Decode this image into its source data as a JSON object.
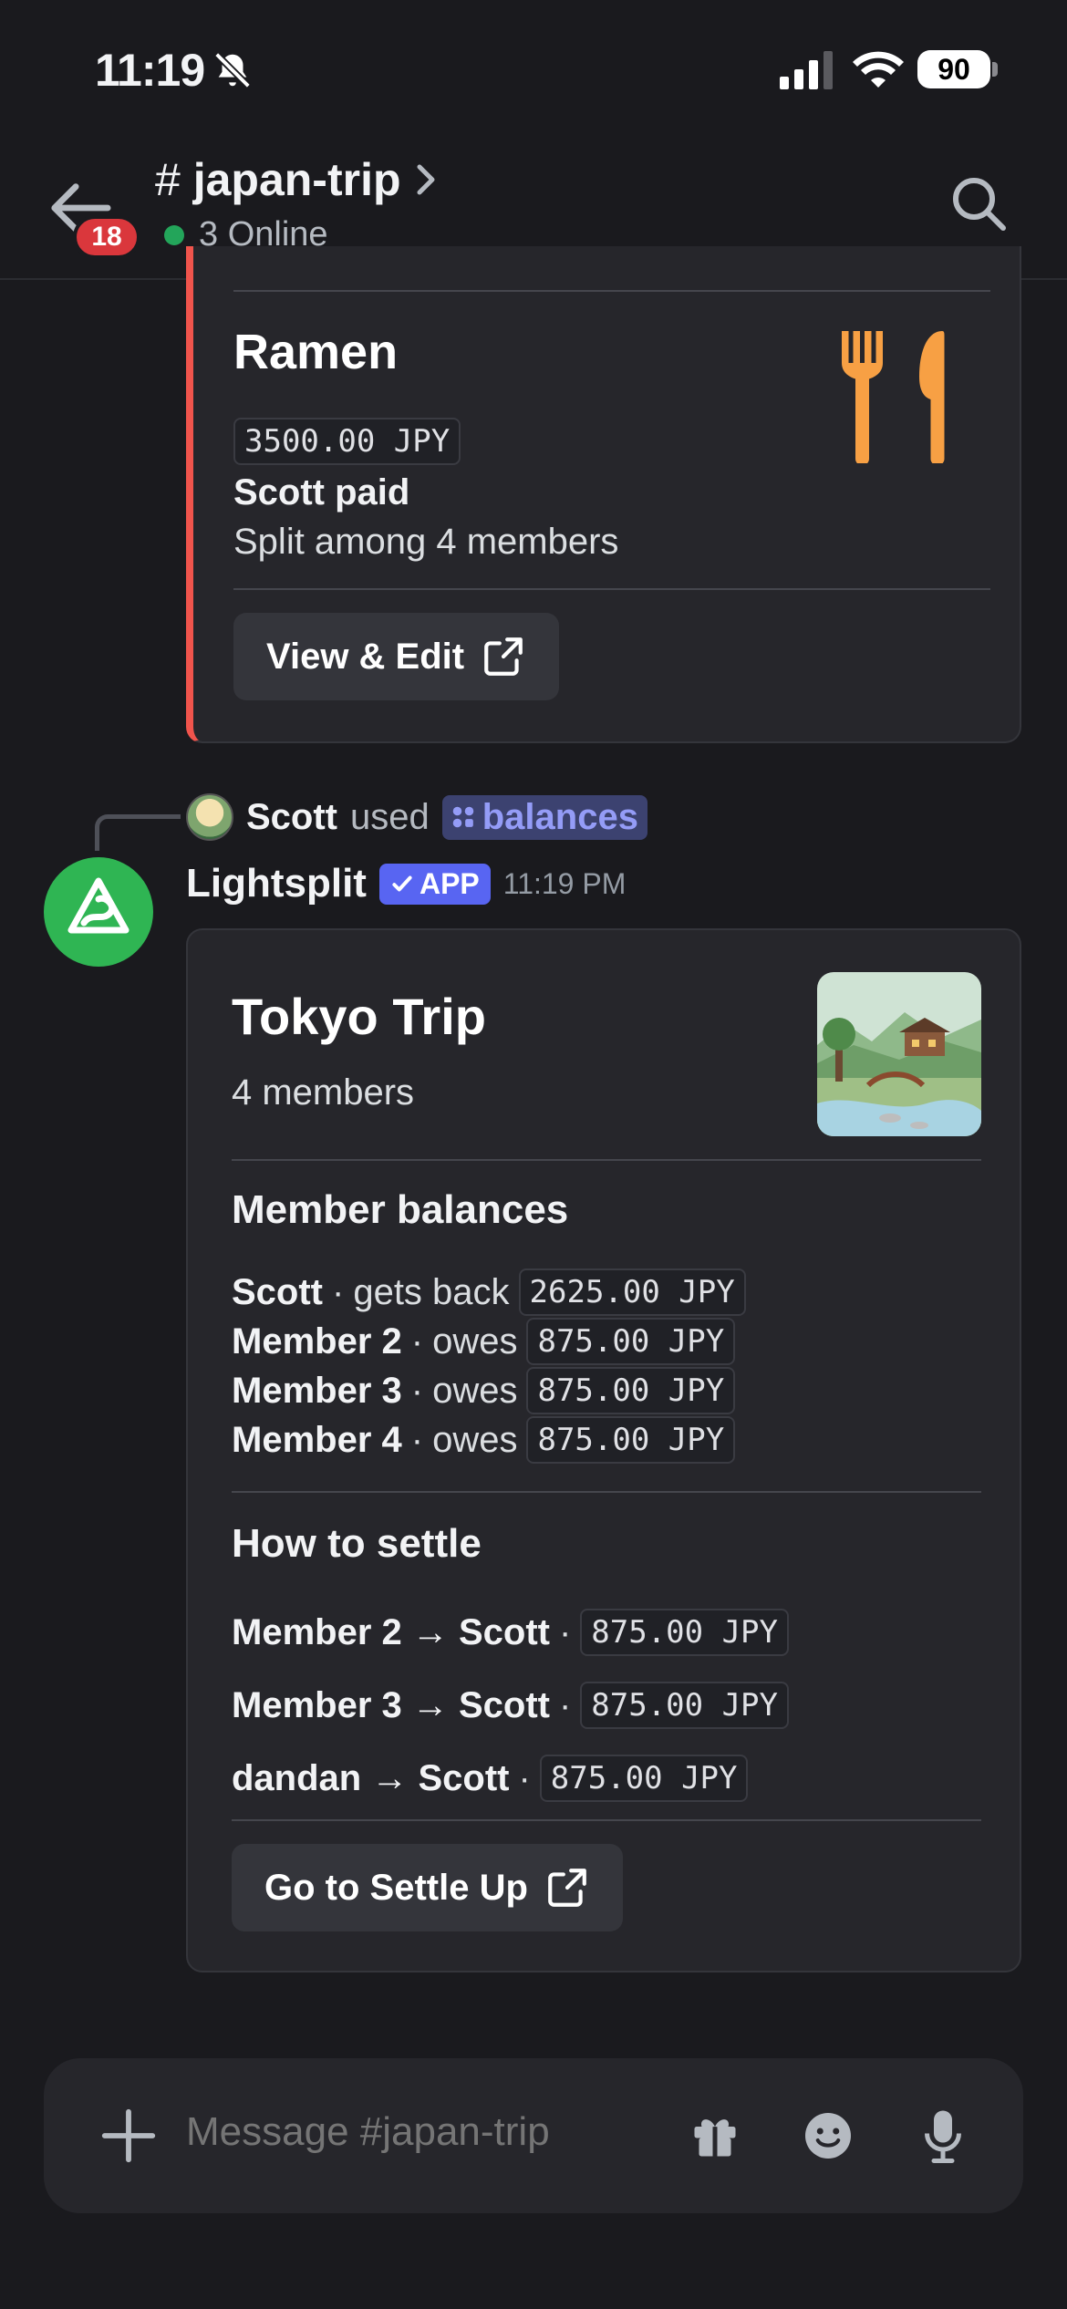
{
  "status_bar": {
    "time": "11:19",
    "battery": "90"
  },
  "header": {
    "unread_count": "18",
    "channel_hash": "#",
    "channel_name": "japan-trip",
    "online_text": "3 Online"
  },
  "ramen_card": {
    "title": "Ramen",
    "amount": "3500.00 JPY",
    "paid_by": "Scott paid",
    "split_text": "Split among 4 members",
    "button_label": "View & Edit",
    "accent_color": "#f0544c",
    "icon": "fork-knife-icon"
  },
  "command": {
    "user": "Scott",
    "used_text": "used",
    "command_name": "balances"
  },
  "bot_message": {
    "name": "Lightsplit",
    "app_tag": "APP",
    "time": "11:19 PM"
  },
  "tokyo_card": {
    "title": "Tokyo Trip",
    "members_text": "4 members",
    "balances_heading": "Member balances",
    "balances": [
      {
        "name": "Scott",
        "sep": "·",
        "action": "gets back",
        "amount": "2625.00 JPY"
      },
      {
        "name": "Member 2",
        "sep": "·",
        "action": "owes",
        "amount": "875.00 JPY"
      },
      {
        "name": "Member 3",
        "sep": "·",
        "action": "owes",
        "amount": "875.00 JPY"
      },
      {
        "name": "Member 4",
        "sep": "·",
        "action": "owes",
        "amount": "875.00 JPY"
      }
    ],
    "settle_heading": "How to settle",
    "settlements": [
      {
        "text": "Member 2 → Scott",
        "sep": "·",
        "amount": "875.00 JPY"
      },
      {
        "text": "Member 3 → Scott",
        "sep": "·",
        "amount": "875.00 JPY"
      },
      {
        "text": "dandan → Scott",
        "sep": "·",
        "amount": "875.00 JPY"
      }
    ],
    "button_label": "Go to Settle Up"
  },
  "composer": {
    "placeholder": "Message #japan-trip"
  },
  "colors": {
    "background": "#1a1a1e",
    "card": "#26262b",
    "online": "#23a55a",
    "brand": "#5865f2",
    "badge": "#da373c",
    "bot_avatar": "#2fb553",
    "icon_orange": "#f7a044"
  }
}
